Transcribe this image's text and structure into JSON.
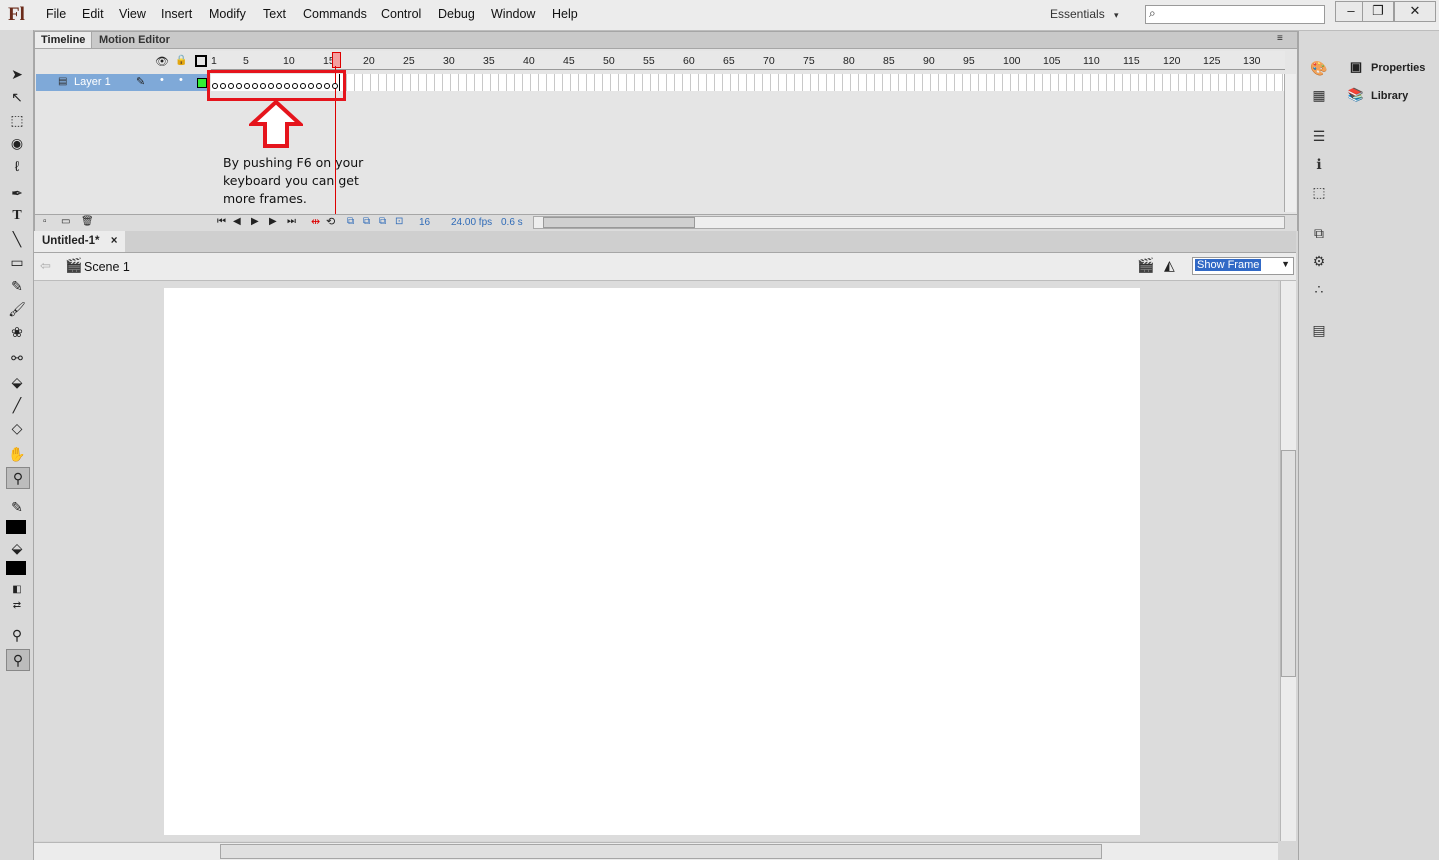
{
  "app": {
    "logo": "Fl"
  },
  "menu": [
    "File",
    "Edit",
    "View",
    "Insert",
    "Modify",
    "Text",
    "Commands",
    "Control",
    "Debug",
    "Window",
    "Help"
  ],
  "workspace": {
    "label": "Essentials",
    "arrow": "▾"
  },
  "window_controls": [
    "–",
    "❐",
    "✕"
  ],
  "timeline": {
    "tabs": [
      "Timeline",
      "Motion Editor"
    ],
    "ruler": [
      "1",
      "5",
      "10",
      "15",
      "20",
      "25",
      "30",
      "35",
      "40",
      "45",
      "50",
      "55",
      "60",
      "65",
      "70",
      "75",
      "80",
      "85",
      "90",
      "95",
      "100",
      "105",
      "110",
      "115",
      "120",
      "125",
      "130"
    ],
    "layer_name": "Layer 1",
    "frame_count": 16,
    "annotation_lines": [
      "By pushing F6 on your",
      "keyboard you can get",
      "more frames."
    ],
    "status": {
      "current_frame": "16",
      "fps": "24.00 fps",
      "elapsed": "0.6 s"
    }
  },
  "document": {
    "tab_title": "Untitled-1*",
    "tab_close": "×",
    "scene": "Scene 1",
    "zoom_select": "Show Frame"
  },
  "panels": {
    "properties": "Properties",
    "library": "Library"
  },
  "colors": {
    "highlight": "#e5141c",
    "layer_selected": "#7fa9d8",
    "playhead": "#dd0000"
  },
  "icons": {
    "tools": [
      "selection-icon",
      "subselection-icon",
      "free-transform-icon",
      "3d-rotation-icon",
      "lasso-icon",
      "pen-icon",
      "text-icon",
      "line-icon",
      "rectangle-icon",
      "pencil-icon",
      "brush-icon",
      "deco-icon",
      "bone-icon",
      "paint-bucket-icon",
      "eyedropper-icon",
      "eraser-icon",
      "hand-icon",
      "zoom-icon"
    ]
  }
}
